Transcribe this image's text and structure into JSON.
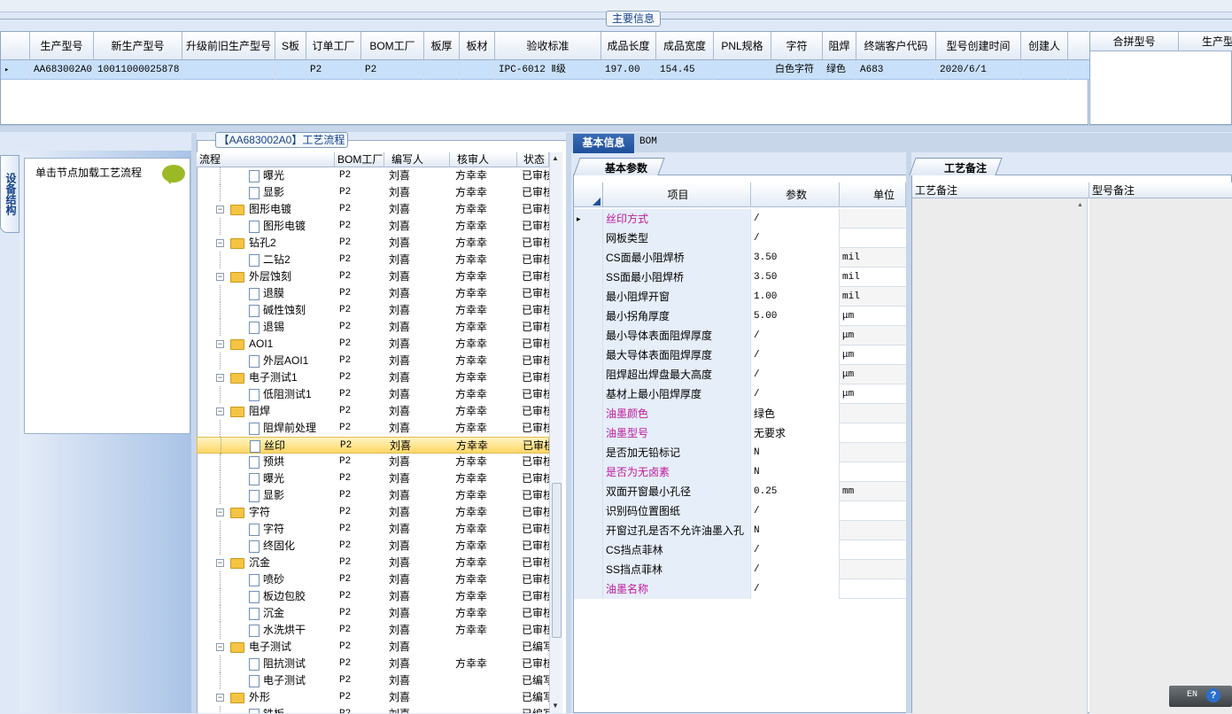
{
  "main_group": {
    "title": "主要信息"
  },
  "main_grid": {
    "columns": [
      "生产型号",
      "新生产型号",
      "升级前旧生产型号",
      "S板",
      "订单工厂",
      "BOM工厂",
      "板厚",
      "板材",
      "验收标准",
      "成品长度",
      "成品宽度",
      "PNL规格",
      "字符",
      "阻焊",
      "终端客户代码",
      "型号创建时间",
      "创建人"
    ],
    "row": [
      "AA683002A0",
      "10011000025878",
      "",
      "",
      "P2",
      "P2",
      "",
      "",
      "IPC-6012 Ⅱ级",
      "197.00",
      "154.45",
      "",
      "白色字符",
      "绿色",
      "A683",
      "2020/6/1",
      ""
    ]
  },
  "side_grid": {
    "columns": [
      "合拼型号",
      "生产型"
    ]
  },
  "left_panel": {
    "vertical_tab": "设备结构",
    "load_text": "单击节点加载工艺流程"
  },
  "tree": {
    "title": "【AA683002A0】工艺流程",
    "columns": [
      "流程",
      "BOM工厂",
      "编写人",
      "核审人",
      "状态"
    ],
    "rows": [
      {
        "name": "曝光",
        "level": 1,
        "type": "doc",
        "bom": "P2",
        "writer": "刘喜",
        "reviewer": "方幸幸",
        "status": "已审核"
      },
      {
        "name": "显影",
        "level": 1,
        "type": "doc",
        "bom": "P2",
        "writer": "刘喜",
        "reviewer": "方幸幸",
        "status": "已审核"
      },
      {
        "name": "图形电镀",
        "level": 0,
        "type": "folder",
        "bom": "P2",
        "writer": "刘喜",
        "reviewer": "方幸幸",
        "status": "已审核"
      },
      {
        "name": "图形电镀",
        "level": 1,
        "type": "doc",
        "bom": "P2",
        "writer": "刘喜",
        "reviewer": "方幸幸",
        "status": "已审核"
      },
      {
        "name": "钻孔2",
        "level": 0,
        "type": "folder",
        "bom": "P2",
        "writer": "刘喜",
        "reviewer": "方幸幸",
        "status": "已审核"
      },
      {
        "name": "二钻2",
        "level": 1,
        "type": "doc",
        "bom": "P2",
        "writer": "刘喜",
        "reviewer": "方幸幸",
        "status": "已审核"
      },
      {
        "name": "外层蚀刻",
        "level": 0,
        "type": "folder",
        "bom": "P2",
        "writer": "刘喜",
        "reviewer": "方幸幸",
        "status": "已审核"
      },
      {
        "name": "退膜",
        "level": 1,
        "type": "doc",
        "bom": "P2",
        "writer": "刘喜",
        "reviewer": "方幸幸",
        "status": "已审核"
      },
      {
        "name": "碱性蚀刻",
        "level": 1,
        "type": "doc",
        "bom": "P2",
        "writer": "刘喜",
        "reviewer": "方幸幸",
        "status": "已审核"
      },
      {
        "name": "退锡",
        "level": 1,
        "type": "doc",
        "bom": "P2",
        "writer": "刘喜",
        "reviewer": "方幸幸",
        "status": "已审核"
      },
      {
        "name": "AOI1",
        "level": 0,
        "type": "folder",
        "bom": "P2",
        "writer": "刘喜",
        "reviewer": "方幸幸",
        "status": "已审核"
      },
      {
        "name": "外层AOI1",
        "level": 1,
        "type": "doc",
        "bom": "P2",
        "writer": "刘喜",
        "reviewer": "方幸幸",
        "status": "已审核"
      },
      {
        "name": "电子测试1",
        "level": 0,
        "type": "folder",
        "bom": "P2",
        "writer": "刘喜",
        "reviewer": "方幸幸",
        "status": "已审核"
      },
      {
        "name": "低阻测试1",
        "level": 1,
        "type": "doc",
        "bom": "P2",
        "writer": "刘喜",
        "reviewer": "方幸幸",
        "status": "已审核"
      },
      {
        "name": "阻焊",
        "level": 0,
        "type": "folder",
        "bom": "P2",
        "writer": "刘喜",
        "reviewer": "方幸幸",
        "status": "已审核"
      },
      {
        "name": "阻焊前处理",
        "level": 1,
        "type": "doc",
        "bom": "P2",
        "writer": "刘喜",
        "reviewer": "方幸幸",
        "status": "已审核"
      },
      {
        "name": "丝印",
        "level": 1,
        "type": "doc",
        "bom": "P2",
        "writer": "刘喜",
        "reviewer": "方幸幸",
        "status": "已审核",
        "selected": true
      },
      {
        "name": "预烘",
        "level": 1,
        "type": "doc",
        "bom": "P2",
        "writer": "刘喜",
        "reviewer": "方幸幸",
        "status": "已审核"
      },
      {
        "name": "曝光",
        "level": 1,
        "type": "doc",
        "bom": "P2",
        "writer": "刘喜",
        "reviewer": "方幸幸",
        "status": "已审核"
      },
      {
        "name": "显影",
        "level": 1,
        "type": "doc",
        "bom": "P2",
        "writer": "刘喜",
        "reviewer": "方幸幸",
        "status": "已审核"
      },
      {
        "name": "字符",
        "level": 0,
        "type": "folder",
        "bom": "P2",
        "writer": "刘喜",
        "reviewer": "方幸幸",
        "status": "已审核"
      },
      {
        "name": "字符",
        "level": 1,
        "type": "doc",
        "bom": "P2",
        "writer": "刘喜",
        "reviewer": "方幸幸",
        "status": "已审核"
      },
      {
        "name": "终固化",
        "level": 1,
        "type": "doc",
        "bom": "P2",
        "writer": "刘喜",
        "reviewer": "方幸幸",
        "status": "已审核"
      },
      {
        "name": "沉金",
        "level": 0,
        "type": "folder",
        "bom": "P2",
        "writer": "刘喜",
        "reviewer": "方幸幸",
        "status": "已审核"
      },
      {
        "name": "喷砂",
        "level": 1,
        "type": "doc",
        "bom": "P2",
        "writer": "刘喜",
        "reviewer": "方幸幸",
        "status": "已审核"
      },
      {
        "name": "板边包胶",
        "level": 1,
        "type": "doc",
        "bom": "P2",
        "writer": "刘喜",
        "reviewer": "方幸幸",
        "status": "已审核"
      },
      {
        "name": "沉金",
        "level": 1,
        "type": "doc",
        "bom": "P2",
        "writer": "刘喜",
        "reviewer": "方幸幸",
        "status": "已审核"
      },
      {
        "name": "水洗烘干",
        "level": 1,
        "type": "doc",
        "bom": "P2",
        "writer": "刘喜",
        "reviewer": "方幸幸",
        "status": "已审核"
      },
      {
        "name": "电子测试",
        "level": 0,
        "type": "folder",
        "bom": "P2",
        "writer": "刘喜",
        "reviewer": "",
        "status": "已编写"
      },
      {
        "name": "阻抗测试",
        "level": 1,
        "type": "doc",
        "bom": "P2",
        "writer": "刘喜",
        "reviewer": "方幸幸",
        "status": "已审核"
      },
      {
        "name": "电子测试",
        "level": 1,
        "type": "doc",
        "bom": "P2",
        "writer": "刘喜",
        "reviewer": "",
        "status": "已编写"
      },
      {
        "name": "外形",
        "level": 0,
        "type": "folder",
        "bom": "P2",
        "writer": "刘喜",
        "reviewer": "",
        "status": "已编写"
      },
      {
        "name": "铣板",
        "level": 1,
        "type": "doc",
        "bom": "P2",
        "writer": "刘喜",
        "reviewer": "",
        "status": "已编写"
      }
    ]
  },
  "right_tabs": {
    "basic": "基本信息",
    "bom": "BOM"
  },
  "params": {
    "tab": "基本参数",
    "columns": [
      "项目",
      "参数",
      "单位"
    ],
    "rows": [
      {
        "item": "丝印方式",
        "value": "/",
        "unit": "",
        "pink": true,
        "current": true
      },
      {
        "item": "网板类型",
        "value": "/",
        "unit": ""
      },
      {
        "item": "CS面最小阻焊桥",
        "value": "3.50",
        "unit": "mil"
      },
      {
        "item": "SS面最小阻焊桥",
        "value": "3.50",
        "unit": "mil"
      },
      {
        "item": "最小阻焊开窗",
        "value": "1.00",
        "unit": "mil"
      },
      {
        "item": "最小拐角厚度",
        "value": "5.00",
        "unit": "μm"
      },
      {
        "item": "最小导体表面阻焊厚度",
        "value": "/",
        "unit": "μm"
      },
      {
        "item": "最大导体表面阻焊厚度",
        "value": "/",
        "unit": "μm"
      },
      {
        "item": "阻焊超出焊盘最大高度",
        "value": "/",
        "unit": "μm"
      },
      {
        "item": "基材上最小阻焊厚度",
        "value": "/",
        "unit": "μm"
      },
      {
        "item": "油墨颜色",
        "value": "绿色",
        "unit": "",
        "pink": true
      },
      {
        "item": "油墨型号",
        "value": "无要求",
        "unit": "",
        "pink": true
      },
      {
        "item": "是否加无铅标记",
        "value": "N",
        "unit": ""
      },
      {
        "item": "是否为无卤素",
        "value": "N",
        "unit": "",
        "pink": true
      },
      {
        "item": "双面开窗最小孔径",
        "value": "0.25",
        "unit": "mm"
      },
      {
        "item": "识别码位置图纸",
        "value": "/",
        "unit": ""
      },
      {
        "item": "开窗过孔是否不允许油墨入孔",
        "value": "N",
        "unit": ""
      },
      {
        "item": "CS挡点菲林",
        "value": "/",
        "unit": ""
      },
      {
        "item": "SS挡点菲林",
        "value": "/",
        "unit": ""
      },
      {
        "item": "油墨名称",
        "value": "/",
        "unit": "",
        "pink": true
      }
    ]
  },
  "remarks": {
    "tab": "工艺备注",
    "col1": "工艺备注",
    "col2": "型号备注"
  },
  "tray": {
    "lang": "EN",
    "help": "?"
  }
}
